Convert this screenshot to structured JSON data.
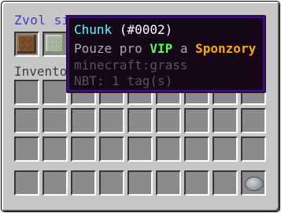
{
  "window": {
    "title": "Zvol si ",
    "inventory_label": "Inventor"
  },
  "slots": {
    "top": [
      "dirt-block",
      "grass-block"
    ],
    "hotbar_item": "stone"
  },
  "tooltip": {
    "name": "Chunk",
    "id": " (#0002)",
    "line2_prefix": "Pouze pro ",
    "line2_vip": "VIP",
    "line2_mid": " a ",
    "line2_sponzory": "Sponzory",
    "line3": "minecraft:grass",
    "line4": "NBT: 1 tag(s)"
  },
  "colors": {
    "panel": "#c6c6c6",
    "title": "#3c3cc4",
    "tooltip_bg": "#150618",
    "tooltip_border": "#3c1272",
    "vip": "#55ff55",
    "sponzory": "#ffaa00",
    "name": "#55ffff"
  }
}
